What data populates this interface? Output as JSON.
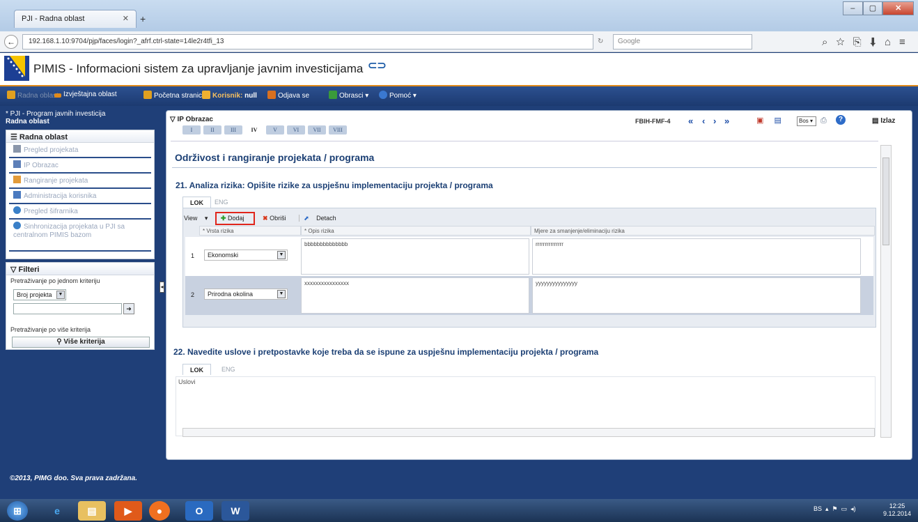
{
  "browser": {
    "tab_title": "PJI - Radna oblast",
    "url": "192.168.1.10:9704/pjp/faces/login?_afrf.ctrl-state=14le2r4tfi_13",
    "search_placeholder": "Google"
  },
  "header": {
    "app_title": "PIMIS - Informacioni sistem za upravljanje javnim investicijama"
  },
  "menu": {
    "radna_oblast": "Radna oblast",
    "izvjestajna": "Izvještajna oblast",
    "pocetna": "Početna stranica",
    "korisnik_label": "Korisnik:",
    "korisnik_value": "null",
    "odjava": "Odjava se",
    "obrasci": "Obrasci",
    "pomoc": "Pomoć"
  },
  "sidebar": {
    "crumb_line1": "* PJI - Program javnih investicija",
    "crumb_line2": "Radna oblast",
    "panel_title": "Radna oblast",
    "items": [
      {
        "label": "Pregled projekata"
      },
      {
        "label": "IP Obrazac"
      },
      {
        "label": "Rangiranje projekata"
      },
      {
        "label": "Administracija korisnika"
      },
      {
        "label": "Pregled šifrarnika"
      },
      {
        "label": "Sinhronizacija projekata u PJI sa centralnom PIMIS bazom"
      }
    ],
    "filters_title": "Filteri",
    "filter_single": "Pretraživanje po jednom kriteriju",
    "filter_select": "Broj projekta",
    "filter_multi": "Pretraživanje po više kriterija",
    "more_criteria": "Više kriterija"
  },
  "main": {
    "panel_title": "IP Obrazac",
    "roman_tabs": [
      "I",
      "II",
      "III",
      "IV",
      "V",
      "VI",
      "VII",
      "VIII"
    ],
    "form_code": "FBIH-FMF-4",
    "lang_select": "Bos",
    "exit": "Izlaz",
    "section_title": "Održivost i rangiranje projekata / programa",
    "q21": "21. Analiza rizika: Opišite rizike za uspješnu implementaciju projekta / programa",
    "q22": "22. Navedite uslove i pretpostavke koje treba da se ispune za uspješnu implementaciju projekta / programa",
    "lang_tabs": [
      "LOK",
      "ENG"
    ],
    "toolbar": {
      "view": "View",
      "add": "Dodaj",
      "delete": "Obriši",
      "detach": "Detach"
    },
    "columns": [
      "* Vrsta rizika",
      "* Opis rizika",
      "Mjere za smanjenje/eliminaciju rizika"
    ],
    "rows": [
      {
        "num": "1",
        "type": "Ekonomski",
        "desc": "bbbbbbbbbbbbbb",
        "measures": "rrrrrrrrrrrrrrr"
      },
      {
        "num": "2",
        "type": "Prirodna okolina",
        "desc": "xxxxxxxxxxxxxxxx",
        "measures": "yyyyyyyyyyyyyyy"
      }
    ],
    "uslovi_label": "Uslovi"
  },
  "footer": {
    "copyright": "©2013, PIMG doo. Sva prava zadržana."
  },
  "taskbar": {
    "lang": "BS",
    "time": "12:25",
    "date": "9.12.2014"
  }
}
